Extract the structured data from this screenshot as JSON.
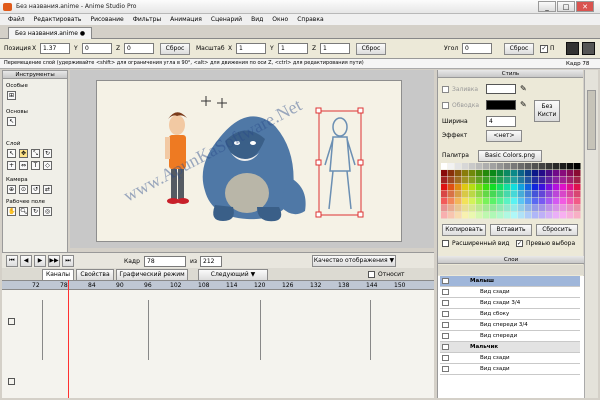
{
  "title_bar": {
    "title": "Без названия.anime - Anime Studio Pro",
    "buttons": [
      "_",
      "□",
      "✕"
    ]
  },
  "menu": [
    "Файл",
    "Редактировать",
    "Рисование",
    "Фильтры",
    "Анимация",
    "Сценарий",
    "Вид",
    "Окно",
    "Справка"
  ],
  "document_tab": "Без названия.anime ●",
  "transform_bar": {
    "position_label": "Позиция",
    "x_label": "X",
    "x_value": "1.37",
    "y_label": "Y",
    "y_value": "0",
    "z_label": "Z",
    "z_value": "0",
    "reset_label": "Сброс",
    "scale_label": "Масштаб",
    "sx_label": "X",
    "sx_value": "1",
    "sy_label": "Y",
    "sy_value": "1",
    "sz_label": "Z",
    "sz_value": "1",
    "reset2_label": "Сброс",
    "angle_label": "Угол",
    "angle_value": "0",
    "reset3_label": "Сброс",
    "flip_label": "П"
  },
  "hint_text": "Перемещение слой (удерживайте <shift> для ограничения угла в 90°, <alt> для движения по оси Z, <ctrl> для редактирования пути)",
  "frame_readout": "Кадр 78",
  "tools": {
    "title": "Инструменты",
    "sections": [
      "Особые",
      "Основы",
      "Слой",
      "Камера",
      "Рабочее поле"
    ]
  },
  "timeline": {
    "frame_label": "Кадр",
    "frame_value": "78",
    "of_label": "из",
    "of_value": "212",
    "quality_label": "Качество отображения ▼",
    "tabs": [
      "Каналы",
      "Свойства",
      "Графический режим",
      "Следующий ▼"
    ],
    "onion_label": "Относит",
    "ruler": [
      "72",
      "78",
      "84",
      "90",
      "96",
      "102",
      "108",
      "114",
      "120",
      "126",
      "132",
      "138",
      "144",
      "150"
    ]
  },
  "style_panel": {
    "title": "Стиль",
    "fill_label": "Заливка",
    "stroke_label": "Обводка",
    "width_label": "Ширина",
    "width_value": "4",
    "no_style": "Без Кисти",
    "effect_label": "Эффект",
    "effect_value": "<нет>",
    "palette_label": "Палитра",
    "palette_value": "Basic Colors.png",
    "copy_label": "Копировать",
    "paste_label": "Вставить",
    "reset_label": "Сбросить",
    "advanced_label": "Расширенный вид",
    "preview_label": "Превью выбора"
  },
  "layers": {
    "title": "Слои",
    "items": [
      "Малыш",
      "Вид сзади",
      "Вид сзади 3/4",
      "Вид сбоку",
      "Вид спереди 3/4",
      "Вид спереди",
      "Мальчик",
      "Вид сзади",
      "Вид сзади"
    ]
  },
  "watermark": "www.ApunKaSoftware.Net",
  "colors": {
    "accent": "#3e6bb5",
    "selected_layer": "#9fb6da",
    "playhead": "#ff3030",
    "gorilla": "#4f78a6",
    "shirt": "#ee7a22",
    "stage": "#f5f2e6"
  },
  "icons": [
    "window-app-icon",
    "eye-icon",
    "sword-icon",
    "layer-type-icon"
  ]
}
